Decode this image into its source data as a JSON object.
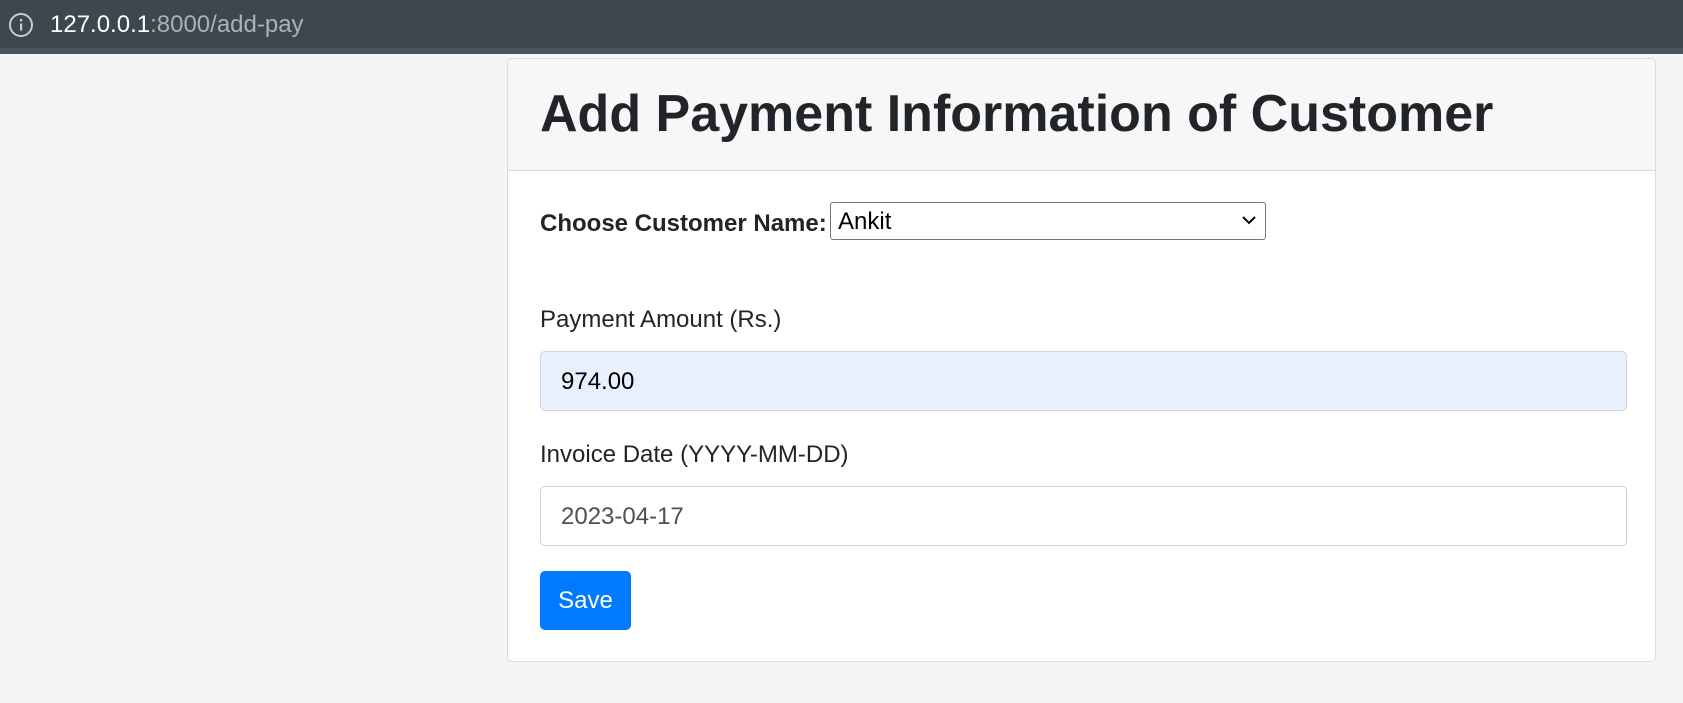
{
  "browser": {
    "url_host": "127.0.0.1",
    "url_rest": ":8000/add-pay",
    "info_icon": "info-icon"
  },
  "form": {
    "title": "Add Payment Information of Customer",
    "customer": {
      "label": "Choose Customer Name:",
      "selected": "Ankit",
      "icon": "chevron-down-icon"
    },
    "amount": {
      "label": "Payment Amount (Rs.)",
      "value": "974.00"
    },
    "invoice_date": {
      "label": "Invoice Date (YYYY-MM-DD)",
      "value": "2023-04-17"
    },
    "save_label": "Save"
  },
  "colors": {
    "primary": "#007bff",
    "autofill": "#e8f0fe",
    "browser_bar": "#3c474f"
  }
}
